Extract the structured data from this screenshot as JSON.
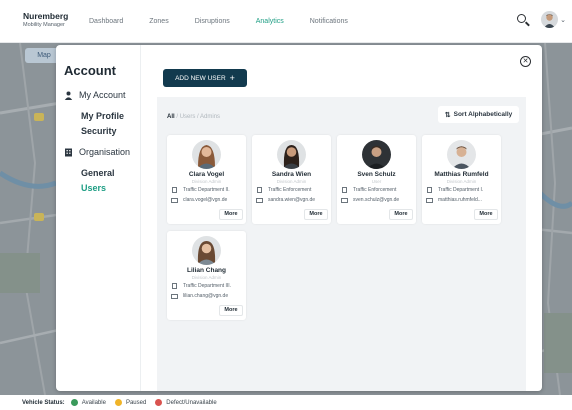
{
  "header": {
    "brand_title": "Nuremberg",
    "brand_subtitle": "Mobility Manager",
    "nav": [
      {
        "label": "Dashboard",
        "active": false
      },
      {
        "label": "Zones",
        "active": false
      },
      {
        "label": "Disruptions",
        "active": false
      },
      {
        "label": "Analytics",
        "active": true
      },
      {
        "label": "Notifications",
        "active": false
      }
    ],
    "search_icon": "search-icon",
    "profile_icon": "chevron-down-icon"
  },
  "map": {
    "tab_label": "Map"
  },
  "sidebar": {
    "title": "Account",
    "sections": [
      {
        "label": "My Account",
        "icon": "person-icon"
      },
      {
        "label": "Organisation",
        "icon": "building-icon"
      }
    ],
    "links": {
      "my_profile": "My Profile",
      "security": "Security",
      "general": "General",
      "users": "Users"
    }
  },
  "actions": {
    "add_user": "ADD NEW USER",
    "add_user_icon": "+",
    "close_icon": "close-icon",
    "sort_label": "Sort Alphabetically"
  },
  "filter": {
    "all": "All",
    "sep1": " / ",
    "users": "Users",
    "sep2": " / ",
    "admins": "Admins"
  },
  "users": [
    {
      "name": "Clara Vogel",
      "role": "Division Admin",
      "department": "Traffic Department II.",
      "email": "clara.vogel@vgn.de",
      "more": "More"
    },
    {
      "name": "Sandra Wien",
      "role": "Division Admin",
      "department": "Traffic Enforcement",
      "email": "sandra.wien@vgn.de",
      "more": "More"
    },
    {
      "name": "Sven Schulz",
      "role": "User",
      "department": "Traffic Enforcement",
      "email": "sven.schulz@vgn.de",
      "more": "More"
    },
    {
      "name": "Matthias Rumfeld",
      "role": "Division Admin",
      "department": "Traffic Department I.",
      "email": "matthias.ruhmfeld...",
      "more": "More"
    },
    {
      "name": "Lilian Chang",
      "role": "Division Admin",
      "department": "Traffic Department III.",
      "email": "lilian.chang@vgn.de",
      "more": "More"
    }
  ],
  "status": {
    "title": "Vehicle Status:",
    "items": [
      {
        "label": "Available",
        "color": "#3a9a5b"
      },
      {
        "label": "Paused",
        "color": "#f0b429"
      },
      {
        "label": "Defect/Unavailable",
        "color": "#d9534f"
      }
    ]
  },
  "colors": {
    "accent": "#1e9e84",
    "primary_button": "#123a4e"
  }
}
